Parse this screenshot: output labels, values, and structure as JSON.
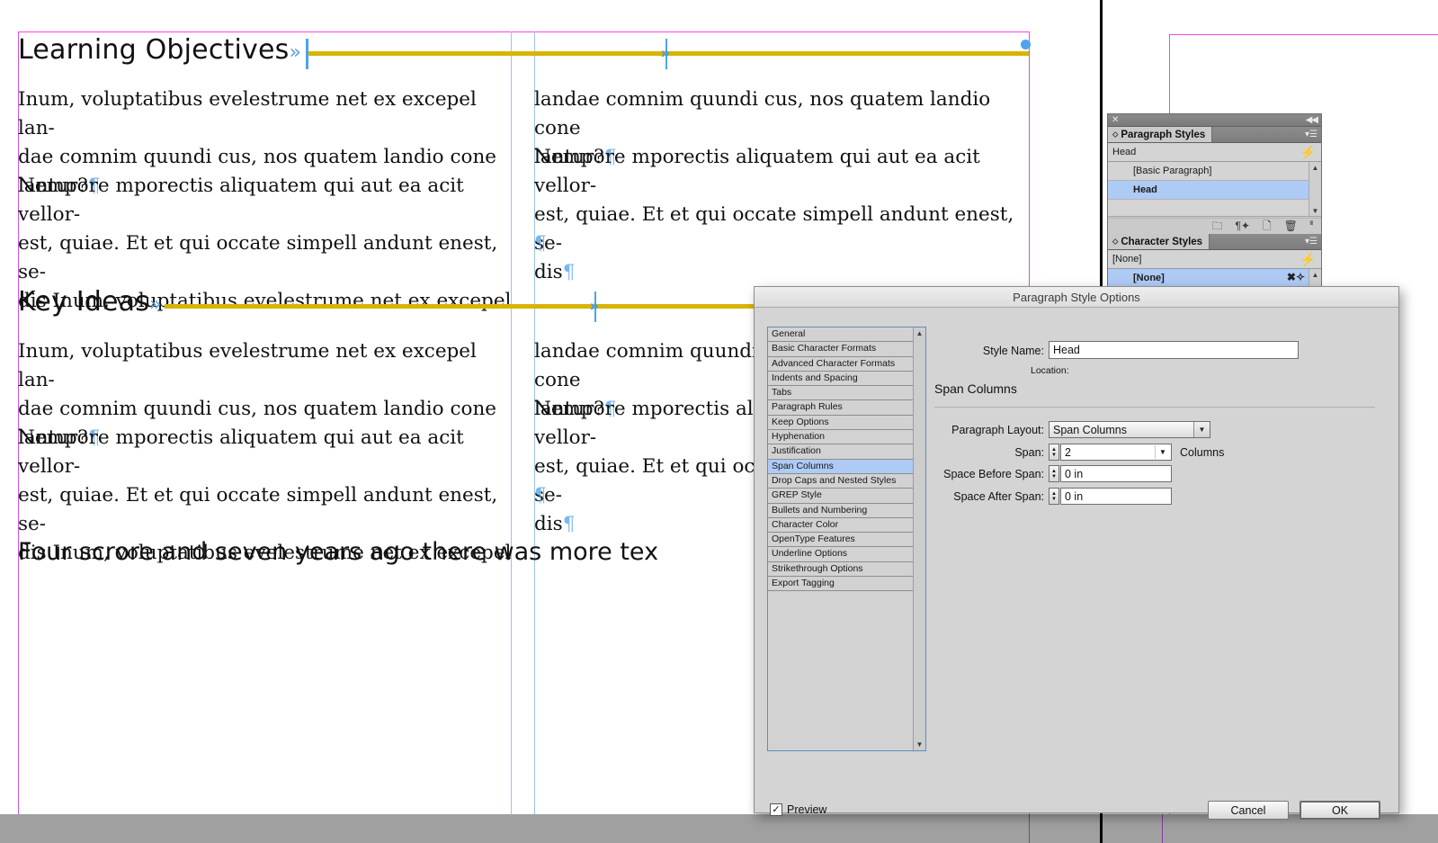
{
  "document": {
    "headings": [
      {
        "text": "Learning Objectives",
        "marker": "»"
      },
      {
        "text": "Key Ideas",
        "marker": "»"
      }
    ],
    "big_line": "Four scrore and seven years ago there was more tex",
    "left_column": {
      "paragraph1": [
        "Inum, voluptatibus evelestrume net ex excepel lan-",
        "dae comnim quundi cus, nos quatem landio cone",
        "lantur?"
      ],
      "paragraph2": [
        "Nempore mporectis aliquatem qui aut ea acit vellor-",
        "est, quiae. Et et qui occate simpell andunt enest, se-",
        "dis Inum, voluptatibus evelestrume net ex excepel"
      ]
    },
    "right_column": {
      "paragraph1": [
        "landae comnim quundi cus, nos quatem landio cone",
        "lantur?"
      ],
      "paragraph2": [
        "Nempore mporectis aliquatem qui aut ea acit vellor-",
        "est, quiae. Et et qui occate simpell andunt enest, se-",
        "dis"
      ],
      "empty_paragraph": "¶"
    },
    "pilcrow": "¶",
    "colors": {
      "margin_guide": "#cc55dd",
      "column_guide": "#9cc3e8",
      "paragraph_rule": "#d8b400",
      "selection_blue": "#4da3f0"
    }
  },
  "styles_panel": {
    "close_label": "✕",
    "collapse_label": "◀◀",
    "paragraph_styles": {
      "tab_label": "Paragraph Styles",
      "grip": "⬦",
      "menu_icon": "▾☰",
      "current_style": "Head",
      "clear_override_icon": "⚡",
      "items": [
        {
          "label": "[Basic Paragraph]",
          "selected": false
        },
        {
          "label": "Head",
          "selected": true
        },
        {
          "label": "",
          "selected": false
        }
      ],
      "scroll_up": "▲",
      "scroll_down": "▼",
      "footer_icons": [
        "folder-icon",
        "clear-overrides-icon",
        "new-style-icon",
        "delete-icon"
      ]
    },
    "character_styles": {
      "tab_label": "Character Styles",
      "grip": "⬦",
      "menu_icon": "▾☰",
      "current_style": "[None]",
      "clear_override_icon": "⚡",
      "items": [
        {
          "label": "[None]",
          "selected": true
        }
      ],
      "scroll_up": "▲"
    }
  },
  "dialog": {
    "title": "Paragraph Style Options",
    "categories": [
      {
        "label": "General",
        "selected": false
      },
      {
        "label": "Basic Character Formats",
        "selected": false
      },
      {
        "label": "Advanced Character Formats",
        "selected": false
      },
      {
        "label": "Indents and Spacing",
        "selected": false
      },
      {
        "label": "Tabs",
        "selected": false
      },
      {
        "label": "Paragraph Rules",
        "selected": false
      },
      {
        "label": "Keep Options",
        "selected": false
      },
      {
        "label": "Hyphenation",
        "selected": false
      },
      {
        "label": "Justification",
        "selected": false
      },
      {
        "label": "Span Columns",
        "selected": true
      },
      {
        "label": "Drop Caps and Nested Styles",
        "selected": false
      },
      {
        "label": "GREP Style",
        "selected": false
      },
      {
        "label": "Bullets and Numbering",
        "selected": false
      },
      {
        "label": "Character Color",
        "selected": false
      },
      {
        "label": "OpenType Features",
        "selected": false
      },
      {
        "label": "Underline Options",
        "selected": false
      },
      {
        "label": "Strikethrough Options",
        "selected": false
      },
      {
        "label": "Export Tagging",
        "selected": false
      }
    ],
    "scroll_up": "▲",
    "scroll_down": "▼",
    "style_name_label": "Style Name:",
    "style_name_value": "Head",
    "location_label": "Location:",
    "location_value": "",
    "section_title": "Span Columns",
    "fields": {
      "paragraph_layout_label": "Paragraph Layout:",
      "paragraph_layout_value": "Span Columns",
      "span_label": "Span:",
      "span_value": "2",
      "span_suffix": "Columns",
      "space_before_label": "Space Before Span:",
      "space_before_value": "0 in",
      "space_after_label": "Space After Span:",
      "space_after_value": "0 in"
    },
    "stepper_up": "▲",
    "stepper_down": "▼",
    "dropdown_arrow": "▼",
    "preview_label": "Preview",
    "preview_checked": "✓",
    "cancel_label": "Cancel",
    "ok_label": "OK"
  }
}
